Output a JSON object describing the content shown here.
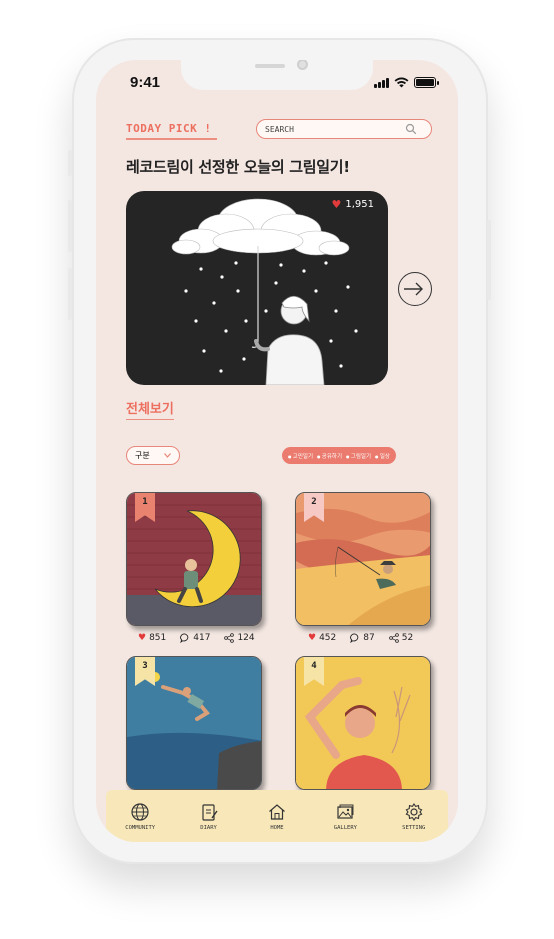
{
  "status_bar": {
    "time": "9:41"
  },
  "header": {
    "today_pick": "TODAY PICK !",
    "search_placeholder": "SEARCH"
  },
  "headline": "레코드림이 선정한 오늘의 그림일기!",
  "featured": {
    "likes": "1,951"
  },
  "view_all": "전체보기",
  "filter": {
    "dropdown_label": "구분",
    "tags": [
      "고민일기",
      "공유하기",
      "그림일기",
      "일상"
    ]
  },
  "cards": [
    {
      "rank": "1",
      "ribbon_color": "#e9826f",
      "likes": "851",
      "comments": "417",
      "shares": "124"
    },
    {
      "rank": "2",
      "ribbon_color": "#f7c9c4",
      "likes": "452",
      "comments": "87",
      "shares": "52"
    },
    {
      "rank": "3",
      "ribbon_color": "#f6e3a6"
    },
    {
      "rank": "4",
      "ribbon_color": "#f6e3a6"
    }
  ],
  "tabs": [
    {
      "label": "COMMUNITY",
      "icon": "globe-icon"
    },
    {
      "label": "DIARY",
      "icon": "diary-icon"
    },
    {
      "label": "HOME",
      "icon": "home-icon"
    },
    {
      "label": "GALLERY",
      "icon": "gallery-icon"
    },
    {
      "label": "SETTING",
      "icon": "gear-icon"
    }
  ],
  "colors": {
    "accent": "#ec6f5f",
    "screen_bg": "#f4e7e2",
    "tabbar_bg": "#f8e8b9",
    "heart": "#e23b3b"
  }
}
